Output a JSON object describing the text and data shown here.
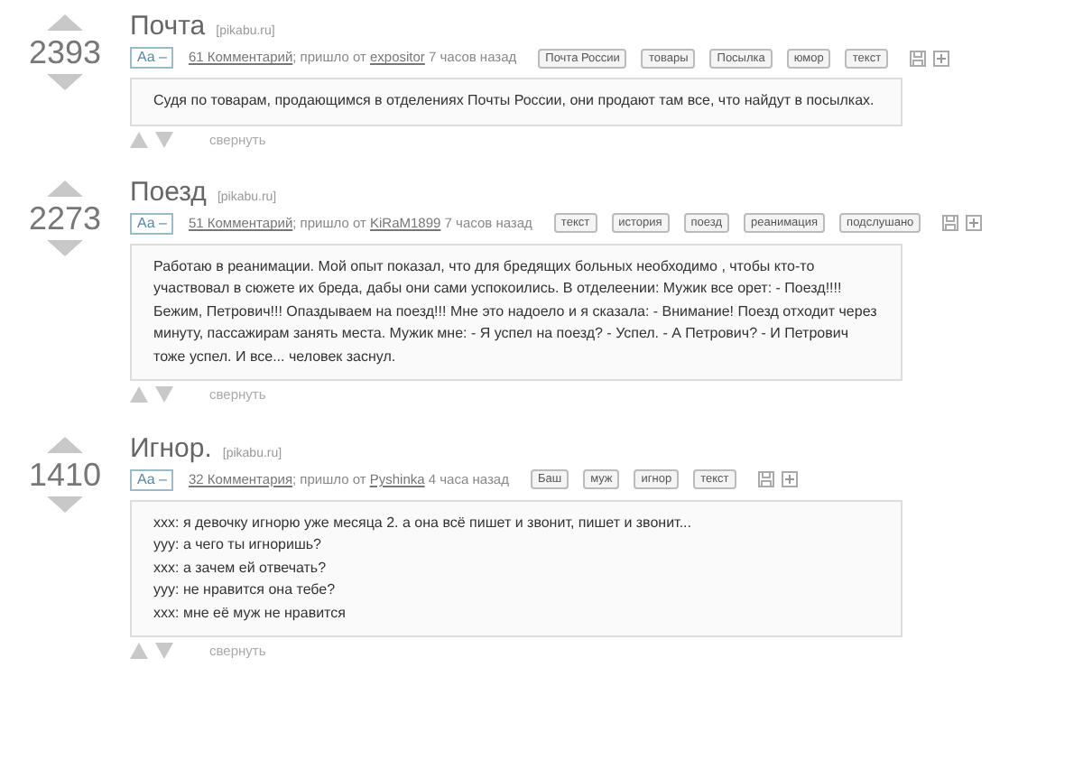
{
  "posts": [
    {
      "rating": "2393",
      "title": "Почта",
      "source": "[pikabu.ru]",
      "font_toggle": "Aa –",
      "comments": "61 Комментарий",
      "from_label": "; пришло от",
      "author": "expositor",
      "time": "7 часов назад",
      "tags": [
        "Почта России",
        "товары",
        "Посылка",
        "юмор",
        "текст"
      ],
      "body": [
        "Судя по товарам, продающимся в отделениях Почты России, они продают там все, что найдут в посылках."
      ],
      "collapse": "свернуть"
    },
    {
      "rating": "2273",
      "title": "Поезд",
      "source": "[pikabu.ru]",
      "font_toggle": "Aa –",
      "comments": "51 Комментарий",
      "from_label": "; пришло от",
      "author": "KiRaM1899",
      "time": "7 часов назад",
      "tags": [
        "текст",
        "история",
        "поезд",
        "реанимация",
        "подслушано"
      ],
      "body": [
        "Работаю в реанимации. Мой опыт показал, что для бредящих больных необходимо , чтобы кто-то участвовал в сюжете их бреда, дабы они сами успокоились. В отделеении: Мужик все орет: - Поезд!!!! Бежим, Петрович!!! Опаздываем на поезд!!! Мне это надоело и я сказала: - Внимание! Поезд отходит через минуту, пассажирам занять места. Мужик мне: - Я успел на поезд? - Успел. - А Петрович? - И Петрович тоже успел. И все... человек заснул."
      ],
      "collapse": "свернуть"
    },
    {
      "rating": "1410",
      "title": "Игнор.",
      "source": "[pikabu.ru]",
      "font_toggle": "Aa –",
      "comments": "32 Комментария",
      "from_label": "; пришло от",
      "author": "Pyshinka",
      "time": "4 часа назад",
      "tags": [
        "Баш",
        "муж",
        "игнор",
        "текст"
      ],
      "body": [
        "xxx: я девочку игнорю уже месяца 2. а она всё пишет и звонит, пишет и звонит...",
        "yyy: а чего ты игноришь?",
        "xxx: а зачем ей отвечать?",
        "yyy: не нравится она тебе?",
        "xxx: мне её муж не нравится"
      ],
      "collapse": "свернуть"
    }
  ]
}
